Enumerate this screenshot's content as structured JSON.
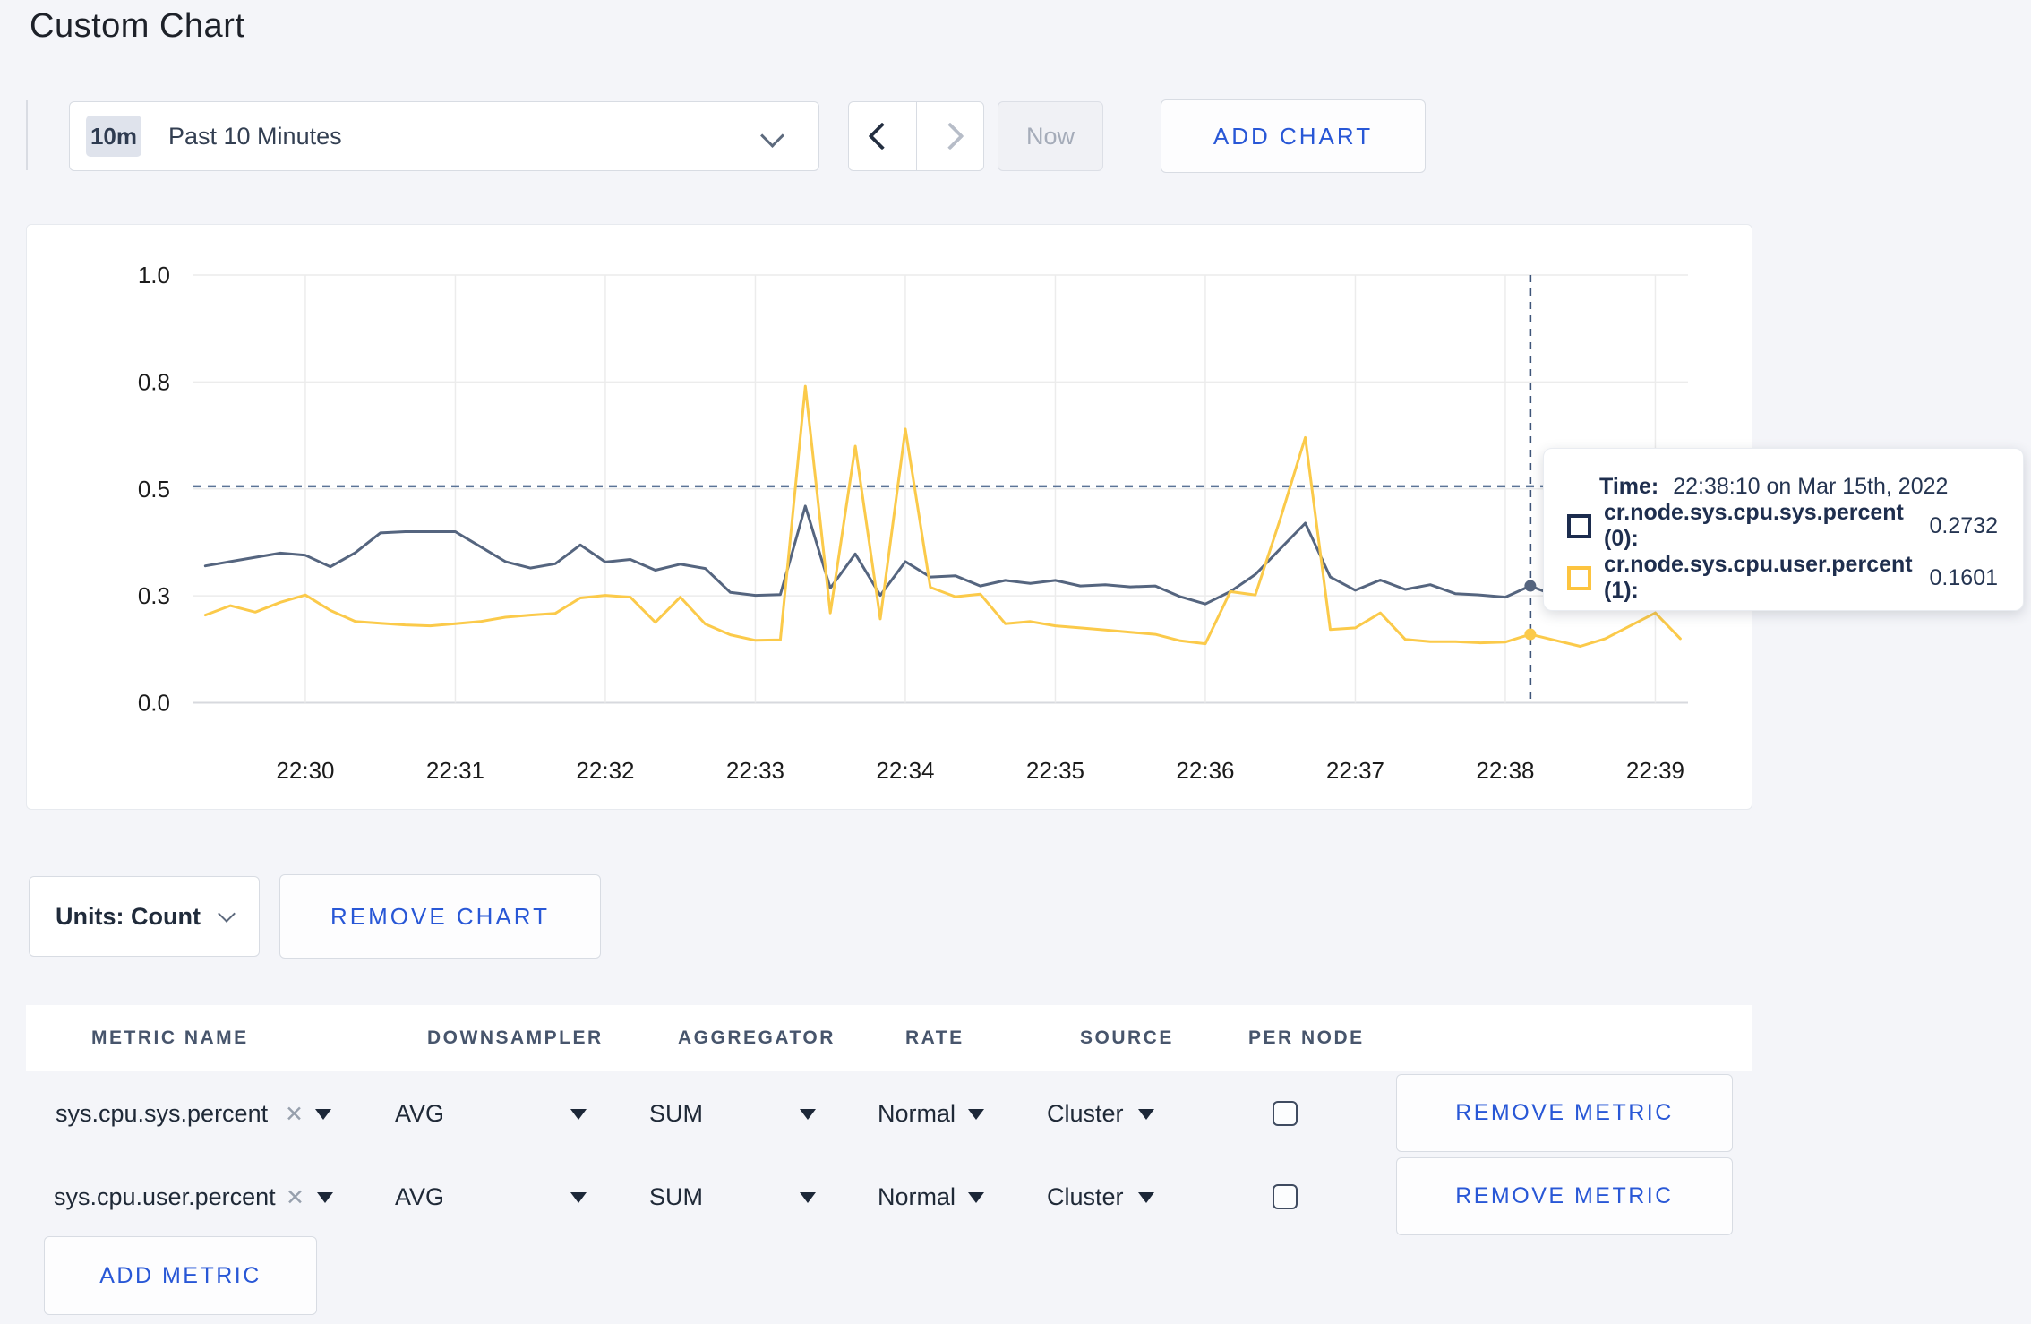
{
  "page": {
    "title": "Custom Chart"
  },
  "toolbar": {
    "range_badge": "10m",
    "range_label": "Past 10 Minutes",
    "now_label": "Now",
    "add_chart_label": "ADD CHART"
  },
  "chart_data": {
    "type": "line",
    "title": "",
    "xlabel": "",
    "ylabel": "",
    "grid": true,
    "legend_position": "none",
    "x_start": "22:29:20",
    "x_step_seconds": 10,
    "x_tick_labels": [
      "22:30",
      "22:31",
      "22:32",
      "22:33",
      "22:34",
      "22:35",
      "22:36",
      "22:37",
      "22:38",
      "22:39"
    ],
    "y_tick_labels": [
      "0.0",
      "0.3",
      "0.5",
      "0.8",
      "1.0"
    ],
    "y_tick_values": [
      0,
      0.25,
      0.5,
      0.75,
      1.0
    ],
    "ylim": [
      0,
      1.0
    ],
    "series": [
      {
        "name": "cr.node.sys.cpu.sys.percent (0)",
        "color": "#55657f",
        "values": [
          0.32,
          0.33,
          0.34,
          0.35,
          0.345,
          0.318,
          0.351,
          0.397,
          0.4,
          0.4,
          0.4,
          0.365,
          0.33,
          0.315,
          0.325,
          0.369,
          0.329,
          0.335,
          0.31,
          0.324,
          0.314,
          0.258,
          0.251,
          0.253,
          0.46,
          0.268,
          0.348,
          0.251,
          0.33,
          0.294,
          0.297,
          0.273,
          0.286,
          0.279,
          0.286,
          0.273,
          0.276,
          0.271,
          0.273,
          0.248,
          0.231,
          0.26,
          0.3,
          0.36,
          0.42,
          0.294,
          0.263,
          0.287,
          0.265,
          0.276,
          0.255,
          0.252,
          0.247,
          0.2732,
          0.25,
          0.26,
          0.25,
          0.27,
          0.28,
          0.27
        ]
      },
      {
        "name": "cr.node.sys.cpu.user.percent (1)",
        "color": "#fbca4a",
        "values": [
          0.205,
          0.227,
          0.212,
          0.235,
          0.252,
          0.216,
          0.19,
          0.186,
          0.182,
          0.18,
          0.185,
          0.19,
          0.2,
          0.205,
          0.209,
          0.245,
          0.251,
          0.247,
          0.188,
          0.247,
          0.184,
          0.159,
          0.146,
          0.147,
          0.74,
          0.21,
          0.6,
          0.196,
          0.64,
          0.27,
          0.248,
          0.254,
          0.185,
          0.19,
          0.18,
          0.175,
          0.17,
          0.165,
          0.16,
          0.145,
          0.138,
          0.26,
          0.252,
          0.43,
          0.62,
          0.171,
          0.175,
          0.21,
          0.148,
          0.143,
          0.143,
          0.14,
          0.142,
          0.1601,
          0.146,
          0.132,
          0.15,
          0.18,
          0.21,
          0.15
        ]
      }
    ],
    "hover": {
      "index": 53,
      "time": "22:38:10",
      "hline_value": 0.506
    }
  },
  "tooltip": {
    "time_label": "Time:",
    "time_value": "22:38:10 on Mar 15th, 2022",
    "rows": [
      {
        "label": "cr.node.sys.cpu.sys.percent (0):",
        "value": "0.2732",
        "swatch_color": "#1c2c4e"
      },
      {
        "label": "cr.node.sys.cpu.user.percent (1):",
        "value": "0.1601",
        "swatch_color": "#fdc43f"
      }
    ]
  },
  "units": {
    "label": "Units: Count",
    "remove_chart_label": "REMOVE CHART"
  },
  "table": {
    "headers": [
      "METRIC NAME",
      "DOWNSAMPLER",
      "AGGREGATOR",
      "RATE",
      "SOURCE",
      "PER NODE"
    ],
    "rows": [
      {
        "metric": "sys.cpu.sys.percent",
        "close": "✕",
        "downsampler": "AVG",
        "aggregator": "SUM",
        "rate": "Normal",
        "source": "Cluster",
        "per_node_checked": false,
        "remove_label": "REMOVE METRIC"
      },
      {
        "metric": "sys.cpu.user.percent",
        "close": "✕",
        "downsampler": "AVG",
        "aggregator": "SUM",
        "rate": "Normal",
        "source": "Cluster",
        "per_node_checked": false,
        "remove_label": "REMOVE METRIC"
      }
    ],
    "add_metric_label": "ADD METRIC"
  }
}
